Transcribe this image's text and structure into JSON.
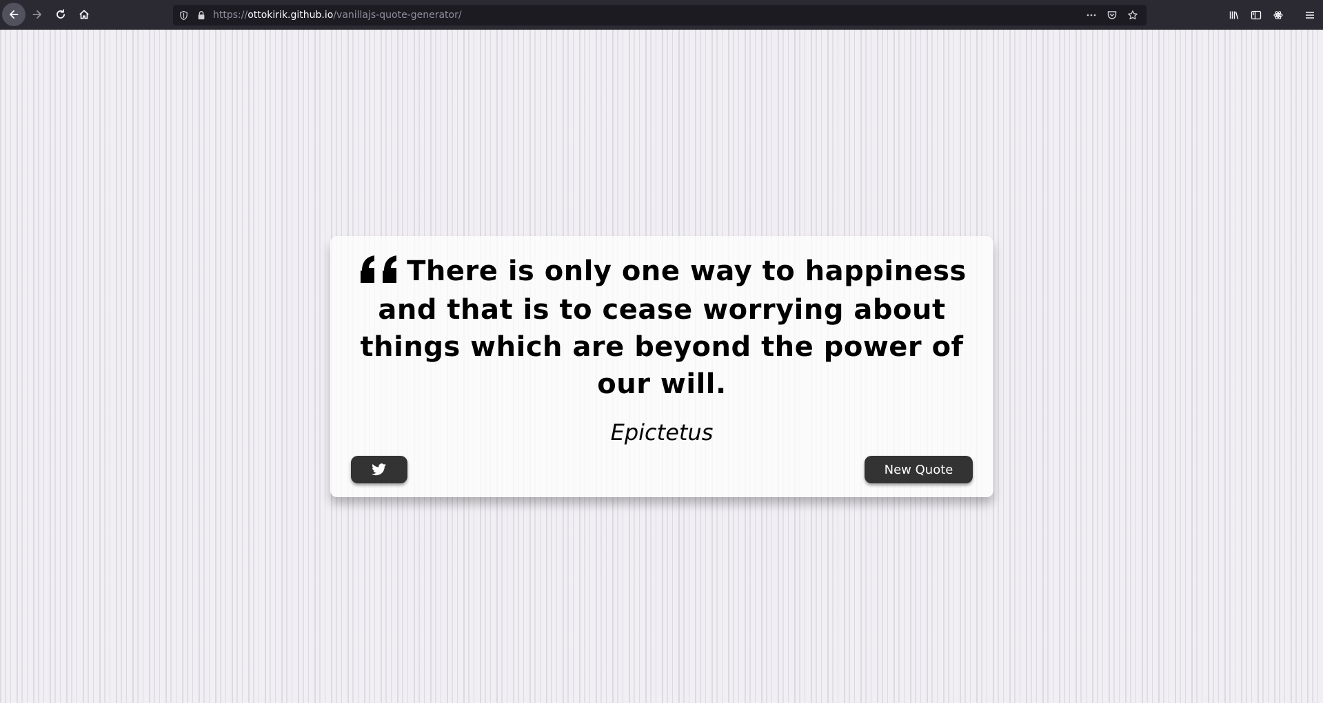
{
  "browser": {
    "url_scheme": "https://",
    "url_host": "ottokirik.github.io",
    "url_path": "/vanillajs-quote-generator/"
  },
  "quote": {
    "text": "There is only one way to happiness and that is to cease worrying about things which are beyond the power of our will.",
    "author": "Epictetus"
  },
  "buttons": {
    "twitter_icon": "twitter-icon",
    "new_quote_label": "New Quote"
  }
}
